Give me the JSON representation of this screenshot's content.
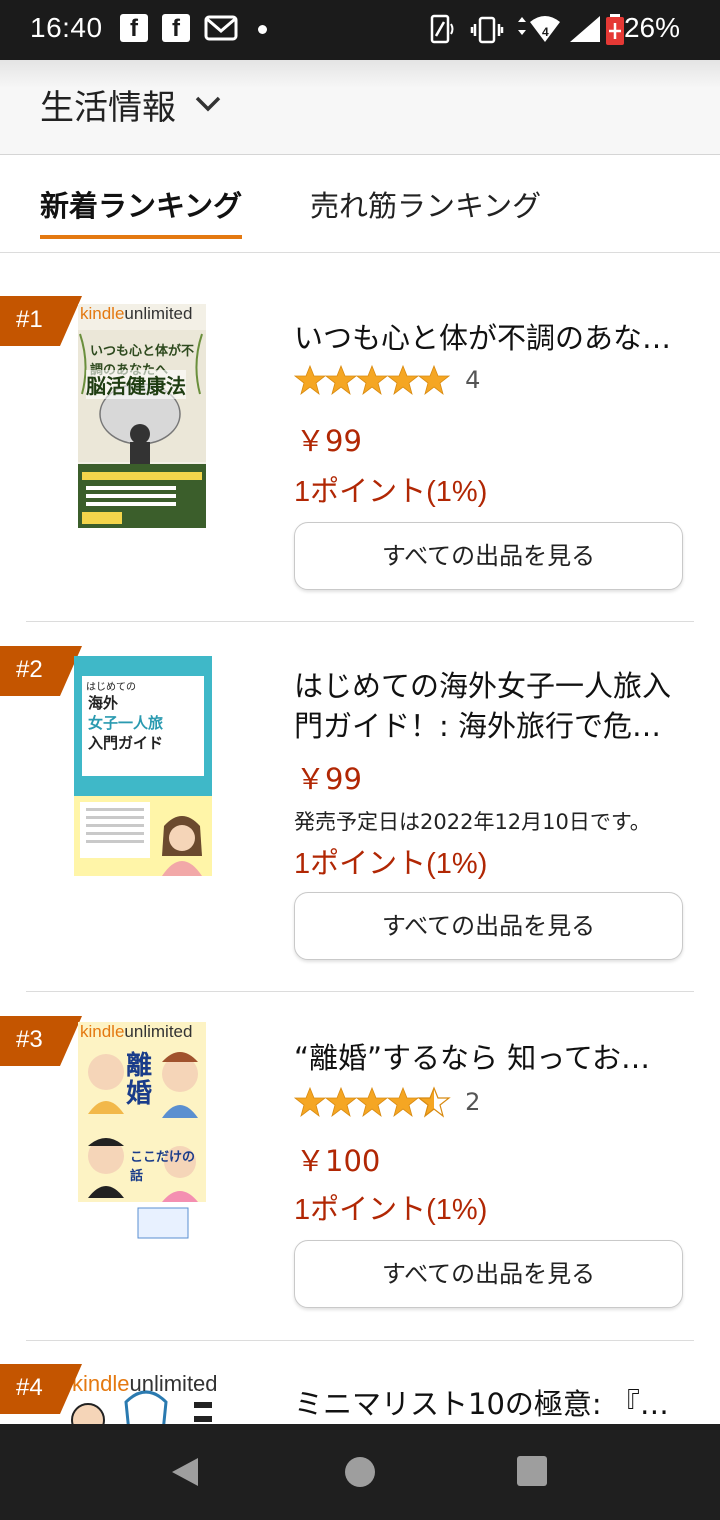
{
  "status_bar": {
    "time": "16:40",
    "app_icons": [
      "facebook-icon",
      "facebook-icon",
      "gmail-icon"
    ],
    "battery": "26%",
    "network": "4"
  },
  "header": {
    "category": "生活情報"
  },
  "tabs": [
    {
      "label": "新着ランキング",
      "active": true
    },
    {
      "label": "売れ筋ランキング",
      "active": false
    }
  ],
  "items": [
    {
      "rank": "#1",
      "title": "いつも心と体が不調のあな…",
      "rating": 5.0,
      "rating_count": "4",
      "price": "￥99",
      "points": "1ポイント(1%)",
      "button": "すべての出品を見る",
      "cover": {
        "badge": "kindleunlimited",
        "title": "脳活健康法",
        "subtitle": "いつも心と体が不調のあなたへ"
      }
    },
    {
      "rank": "#2",
      "title": "はじめての海外女子一人旅入門ガイド！: 海外旅行で危…",
      "price": "￥99",
      "release": "発売予定日は2022年12月10日です。",
      "points": "1ポイント(1%)",
      "button": "すべての出品を見る",
      "cover": {
        "label": "はじめての",
        "title1": "海外",
        "title2": "女子一人旅",
        "title3": "入門ガイド"
      }
    },
    {
      "rank": "#3",
      "title": "“離婚”するなら 知ってお…",
      "rating": 4.5,
      "rating_count": "2",
      "price": "￥100",
      "points": "1ポイント(1%)",
      "button": "すべての出品を見る",
      "cover": {
        "badge": "kindleunlimited",
        "title": "離婚",
        "subtitle": "ここだけの話"
      }
    },
    {
      "rank": "#4",
      "title": "ミニマリスト10の極意: 『…",
      "cover": {
        "badge": "kindleunlimited"
      }
    }
  ],
  "colors": {
    "accent": "#e47911",
    "price": "#b12704",
    "badge": "#c45500",
    "star": "#f5a623"
  }
}
